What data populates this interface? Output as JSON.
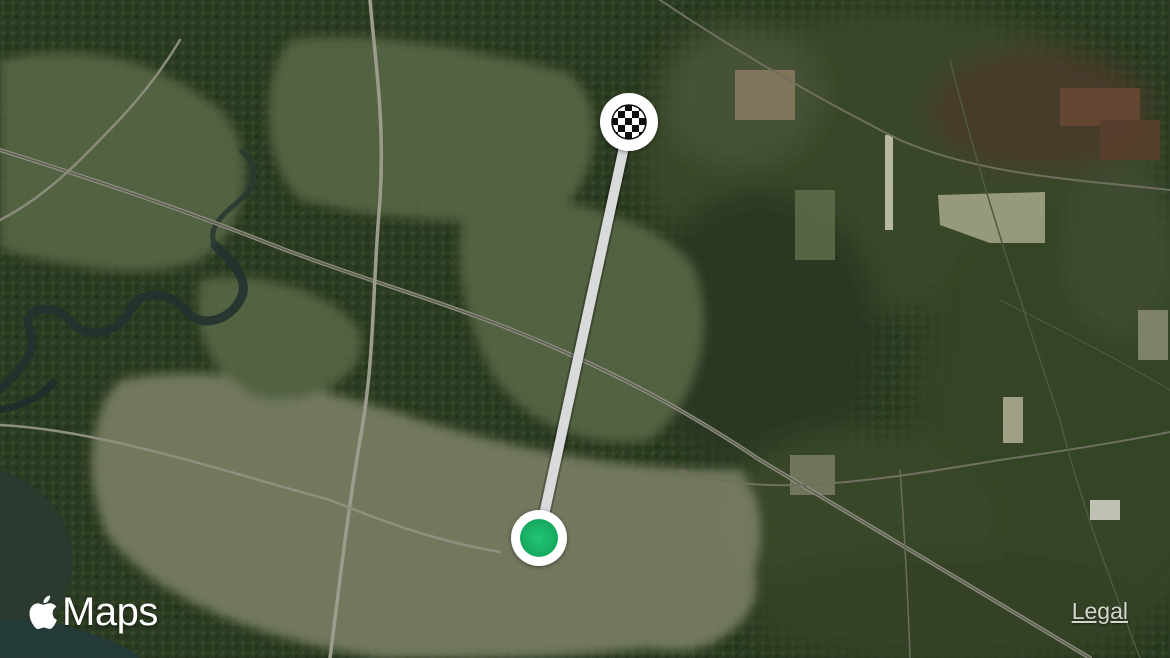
{
  "map": {
    "view": "satellite",
    "brand": {
      "icon": "apple-logo-icon",
      "label": "Maps"
    },
    "legal_label": "Legal",
    "route": {
      "line_color": "#d9dadb",
      "origin": {
        "icon": "origin-marker-icon",
        "color": "#1cb569"
      },
      "destination": {
        "icon": "checkered-flag-icon"
      }
    }
  }
}
